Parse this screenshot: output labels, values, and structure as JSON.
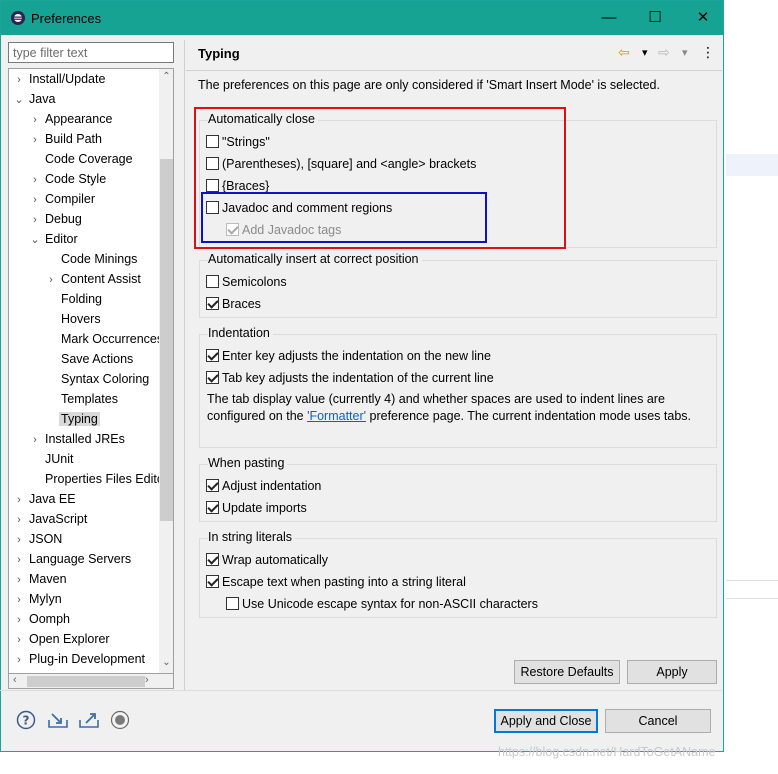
{
  "window": {
    "title": "Preferences",
    "controls": {
      "minimize": "—",
      "maximize": "☐",
      "close": "✕"
    }
  },
  "filter": {
    "placeholder": "type filter text"
  },
  "tree": {
    "items": [
      {
        "label": "Install/Update",
        "expander": "›"
      },
      {
        "label": "Java",
        "expander": "⌄"
      },
      {
        "label": "Appearance",
        "expander": "›"
      },
      {
        "label": "Build Path",
        "expander": "›"
      },
      {
        "label": "Code Coverage",
        "expander": ""
      },
      {
        "label": "Code Style",
        "expander": "›"
      },
      {
        "label": "Compiler",
        "expander": "›"
      },
      {
        "label": "Debug",
        "expander": "›"
      },
      {
        "label": "Editor",
        "expander": "⌄"
      },
      {
        "label": "Code Minings",
        "expander": ""
      },
      {
        "label": "Content Assist",
        "expander": "›"
      },
      {
        "label": "Folding",
        "expander": ""
      },
      {
        "label": "Hovers",
        "expander": ""
      },
      {
        "label": "Mark Occurrences",
        "expander": ""
      },
      {
        "label": "Save Actions",
        "expander": ""
      },
      {
        "label": "Syntax Coloring",
        "expander": ""
      },
      {
        "label": "Templates",
        "expander": ""
      },
      {
        "label": "Typing",
        "expander": "",
        "selected": true
      },
      {
        "label": "Installed JREs",
        "expander": "›"
      },
      {
        "label": "JUnit",
        "expander": ""
      },
      {
        "label": "Properties Files Editor",
        "expander": ""
      },
      {
        "label": "Java EE",
        "expander": "›"
      },
      {
        "label": "JavaScript",
        "expander": "›"
      },
      {
        "label": "JSON",
        "expander": "›"
      },
      {
        "label": "Language Servers",
        "expander": "›"
      },
      {
        "label": "Maven",
        "expander": "›"
      },
      {
        "label": "Mylyn",
        "expander": "›"
      },
      {
        "label": "Oomph",
        "expander": "›"
      },
      {
        "label": "Open Explorer",
        "expander": "›"
      },
      {
        "label": "Plug-in Development",
        "expander": "›"
      }
    ]
  },
  "page": {
    "title": "Typing",
    "description": "The preferences on this page are only considered if 'Smart Insert Mode' is selected.",
    "nav": {
      "back": "⇦",
      "back_menu": "▾",
      "forward": "⇨",
      "forward_menu": "▾",
      "more": "⋮"
    },
    "groups": {
      "auto_close": {
        "title": "Automatically close",
        "options": [
          {
            "label": "\"Strings\"",
            "checked": false
          },
          {
            "label": "(Parentheses), [square] and <angle> brackets",
            "checked": false
          },
          {
            "label": "{Braces}",
            "checked": false
          },
          {
            "label": "Javadoc and comment regions",
            "checked": false
          },
          {
            "label": "Add Javadoc tags",
            "checked": true,
            "disabled": true
          }
        ]
      },
      "auto_insert": {
        "title": "Automatically insert at correct position",
        "options": [
          {
            "label": "Semicolons",
            "checked": false
          },
          {
            "label": "Braces",
            "checked": true
          }
        ]
      },
      "indentation": {
        "title": "Indentation",
        "options": [
          {
            "label": "Enter key adjusts the indentation on the new line",
            "checked": true
          },
          {
            "label": "Tab key adjusts the indentation of the current line",
            "checked": true
          }
        ],
        "text_before": "The tab display value (currently 4) and whether spaces are used to indent lines are configured on the ",
        "link": "'Formatter'",
        "text_after": " preference page. The current indentation mode uses tabs."
      },
      "pasting": {
        "title": "When pasting",
        "options": [
          {
            "label": "Adjust indentation",
            "checked": true
          },
          {
            "label": "Update imports",
            "checked": true
          }
        ]
      },
      "string_literals": {
        "title": "In string literals",
        "options": [
          {
            "label": "Wrap automatically",
            "checked": true
          },
          {
            "label": "Escape text when pasting into a string literal",
            "checked": true
          },
          {
            "label": "Use Unicode escape syntax for non-ASCII characters",
            "checked": false
          }
        ]
      }
    },
    "buttons": {
      "restore_defaults": "Restore Defaults",
      "apply": "Apply"
    }
  },
  "footer": {
    "apply_and_close": "Apply and Close",
    "cancel": "Cancel"
  },
  "watermark": "https://blog.csdn.net/HardToGetAName",
  "colors": {
    "titlebar": "#17a394",
    "highlight_red": "#e01010",
    "highlight_blue": "#1010c8",
    "link": "#0066cc"
  }
}
